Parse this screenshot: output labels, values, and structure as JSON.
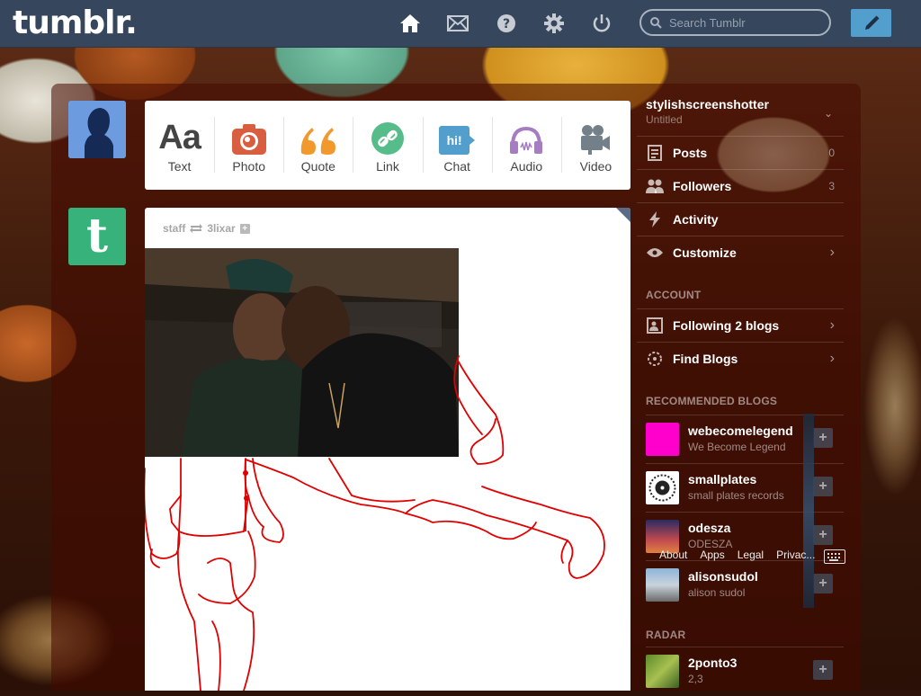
{
  "header": {
    "logo": "tumblr.",
    "search_placeholder": "Search Tumblr",
    "nav_icons": [
      "home-icon",
      "inbox-icon",
      "help-icon",
      "settings-icon",
      "logout-icon"
    ],
    "compose_icon": "pencil-icon"
  },
  "post_types": [
    {
      "label": "Text",
      "icon": "Aa"
    },
    {
      "label": "Photo",
      "icon": "camera-icon"
    },
    {
      "label": "Quote",
      "icon": "quote-icon"
    },
    {
      "label": "Link",
      "icon": "link-icon"
    },
    {
      "label": "Chat",
      "icon": "hi!"
    },
    {
      "label": "Audio",
      "icon": "headphones-icon"
    },
    {
      "label": "Video",
      "icon": "video-camera-icon"
    }
  ],
  "post": {
    "author": "staff",
    "reblogged_from": "3lixar"
  },
  "sidebar": {
    "blog_name": "stylishscreenshotter",
    "blog_subtitle": "Untitled",
    "menu": [
      {
        "label": "Posts",
        "count": "0"
      },
      {
        "label": "Followers",
        "count": "3"
      },
      {
        "label": "Activity"
      },
      {
        "label": "Customize"
      }
    ],
    "account_heading": "ACCOUNT",
    "account": [
      {
        "label": "Following 2 blogs"
      },
      {
        "label": "Find Blogs"
      }
    ],
    "recommended_heading": "RECOMMENDED BLOGS",
    "recommended": [
      {
        "name": "webecomelegend",
        "subtitle": "We Become Legend"
      },
      {
        "name": "smallplates",
        "subtitle": "small plates records"
      },
      {
        "name": "odesza",
        "subtitle": "ODESZA"
      },
      {
        "name": "alisonsudol",
        "subtitle": "alison sudol"
      }
    ],
    "radar_heading": "RADAR",
    "radar": [
      {
        "name": "2ponto3",
        "subtitle": "2,3"
      }
    ]
  },
  "footer": {
    "links": [
      "About",
      "Apps",
      "Legal",
      "Privac..."
    ]
  },
  "colors": {
    "header_bg": "#36465d",
    "accent_blue": "#529ecc",
    "photo_red": "#d95e40",
    "quote_orange": "#f2992e",
    "link_green": "#56bc8a",
    "chat_blue": "#529ecc",
    "audio_purple": "#a77dc2",
    "video_gray": "#748089",
    "drawing_red": "#e00000"
  }
}
